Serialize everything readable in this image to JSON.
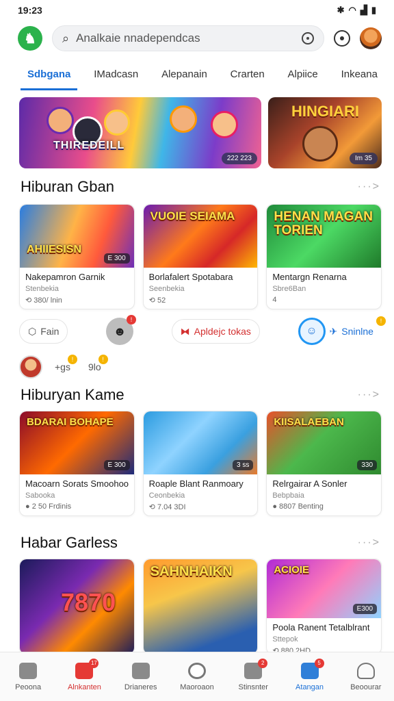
{
  "status": {
    "time": "19:23"
  },
  "topbar": {
    "search_placeholder": "Analkaie nnadependcas"
  },
  "tabs": [
    "Sdbgana",
    "IMadcasn",
    "Alepanain",
    "Crarten",
    "Alpiice",
    "Inkeana"
  ],
  "banners": [
    {
      "title": "THIREDEILL",
      "badge": "222 223"
    },
    {
      "title": "HINGIARI",
      "badge": "Im 35"
    }
  ],
  "section1": {
    "title": "Hiburan Gban",
    "more": "···>",
    "cards": [
      {
        "art_label": "AHIIESISN",
        "tag": "E 300",
        "name": "Nakepamron Garnik",
        "sub": "Stenbekia",
        "meta": "380/ lnin"
      },
      {
        "art_label": "VUOIE SEIAMA",
        "tag": "",
        "name": "Borlafalert Spotabara",
        "sub": "Seenbekia",
        "meta": "52"
      },
      {
        "art_label": "HENAN MAGAN TORIEN",
        "tag": "",
        "name": "Mentargn Renarna",
        "sub": "Sbre6Ban",
        "meta": "4"
      }
    ]
  },
  "chips": [
    {
      "label": "Fain"
    },
    {
      "label": "Apldejc tokas"
    },
    {
      "label": "Sninlne"
    }
  ],
  "mini": [
    "+gs",
    "9lo"
  ],
  "section2": {
    "title": "Hiburyan Kame",
    "more": "···>",
    "cards": [
      {
        "art_label": "BDARAI BOHAPE",
        "tag": "E 300",
        "name": "Macoarn Sorats Smoohoo",
        "sub": "Sabooka",
        "meta": "2 50 Frdinis"
      },
      {
        "art_label": "",
        "tag": "3 ss",
        "name": "Roaple Blant Ranmoary",
        "sub": "Ceonbekia",
        "meta": "7.04 3DI"
      },
      {
        "art_label": "KIISALAEBAN",
        "tag": "330",
        "name": "Relrgairar A Sonler",
        "sub": "Bebpbaia",
        "meta": "8807 Benting"
      }
    ]
  },
  "section3": {
    "title": "Habar Garless",
    "more": "···>",
    "cards": [
      {
        "art_label": "7870",
        "tag": "",
        "name": "",
        "sub": "",
        "meta": ""
      },
      {
        "art_label": "SAHNHAIKN",
        "tag": "",
        "name": "",
        "sub": "",
        "meta": ""
      },
      {
        "art_label": "ACIOIE",
        "tag": "E300",
        "name": "Poola Ranent Tetalblrant",
        "sub": "Sttepok",
        "meta": "880 2HD"
      }
    ]
  },
  "bottomnav": [
    {
      "label": "Peoona",
      "badge": ""
    },
    {
      "label": "Alnkanten",
      "badge": "17"
    },
    {
      "label": "Drianeres",
      "badge": ""
    },
    {
      "label": "Maoroaon",
      "badge": ""
    },
    {
      "label": "Stinsnter",
      "badge": "2"
    },
    {
      "label": "Atangan",
      "badge": "5"
    },
    {
      "label": "Beoourar",
      "badge": ""
    }
  ],
  "colors": {
    "accent": "#1a6fd6",
    "brand": "#2bb24c",
    "alert": "#e53935"
  }
}
